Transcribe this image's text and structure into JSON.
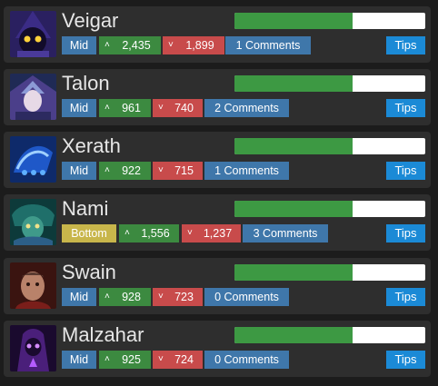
{
  "colors": {
    "card_bg": "#2e2e2e",
    "win_fill": "#3d9943",
    "bar_bg": "#ffffff",
    "lane_blue": "#3f77aa",
    "lane_bottom": "#c8b64b",
    "upvote_green": "#3c8a40",
    "downvote_red": "#c84b4b",
    "tips_blue": "#1b8ad6"
  },
  "icons": {
    "upvote": "chevron-up-icon",
    "downvote": "chevron-down-icon"
  },
  "champions": [
    {
      "name": "Veigar",
      "lane": "Mid",
      "upvotes": "2,435",
      "downvotes": "1,899",
      "comments": "1 Comments",
      "tips": "Tips",
      "win_fraction": 0.62
    },
    {
      "name": "Talon",
      "lane": "Mid",
      "upvotes": "961",
      "downvotes": "740",
      "comments": "2 Comments",
      "tips": "Tips",
      "win_fraction": 0.62
    },
    {
      "name": "Xerath",
      "lane": "Mid",
      "upvotes": "922",
      "downvotes": "715",
      "comments": "1 Comments",
      "tips": "Tips",
      "win_fraction": 0.62
    },
    {
      "name": "Nami",
      "lane": "Bottom",
      "upvotes": "1,556",
      "downvotes": "1,237",
      "comments": "3 Comments",
      "tips": "Tips",
      "win_fraction": 0.62
    },
    {
      "name": "Swain",
      "lane": "Mid",
      "upvotes": "928",
      "downvotes": "723",
      "comments": "0 Comments",
      "tips": "Tips",
      "win_fraction": 0.62
    },
    {
      "name": "Malzahar",
      "lane": "Mid",
      "upvotes": "925",
      "downvotes": "724",
      "comments": "0 Comments",
      "tips": "Tips",
      "win_fraction": 0.62
    }
  ]
}
